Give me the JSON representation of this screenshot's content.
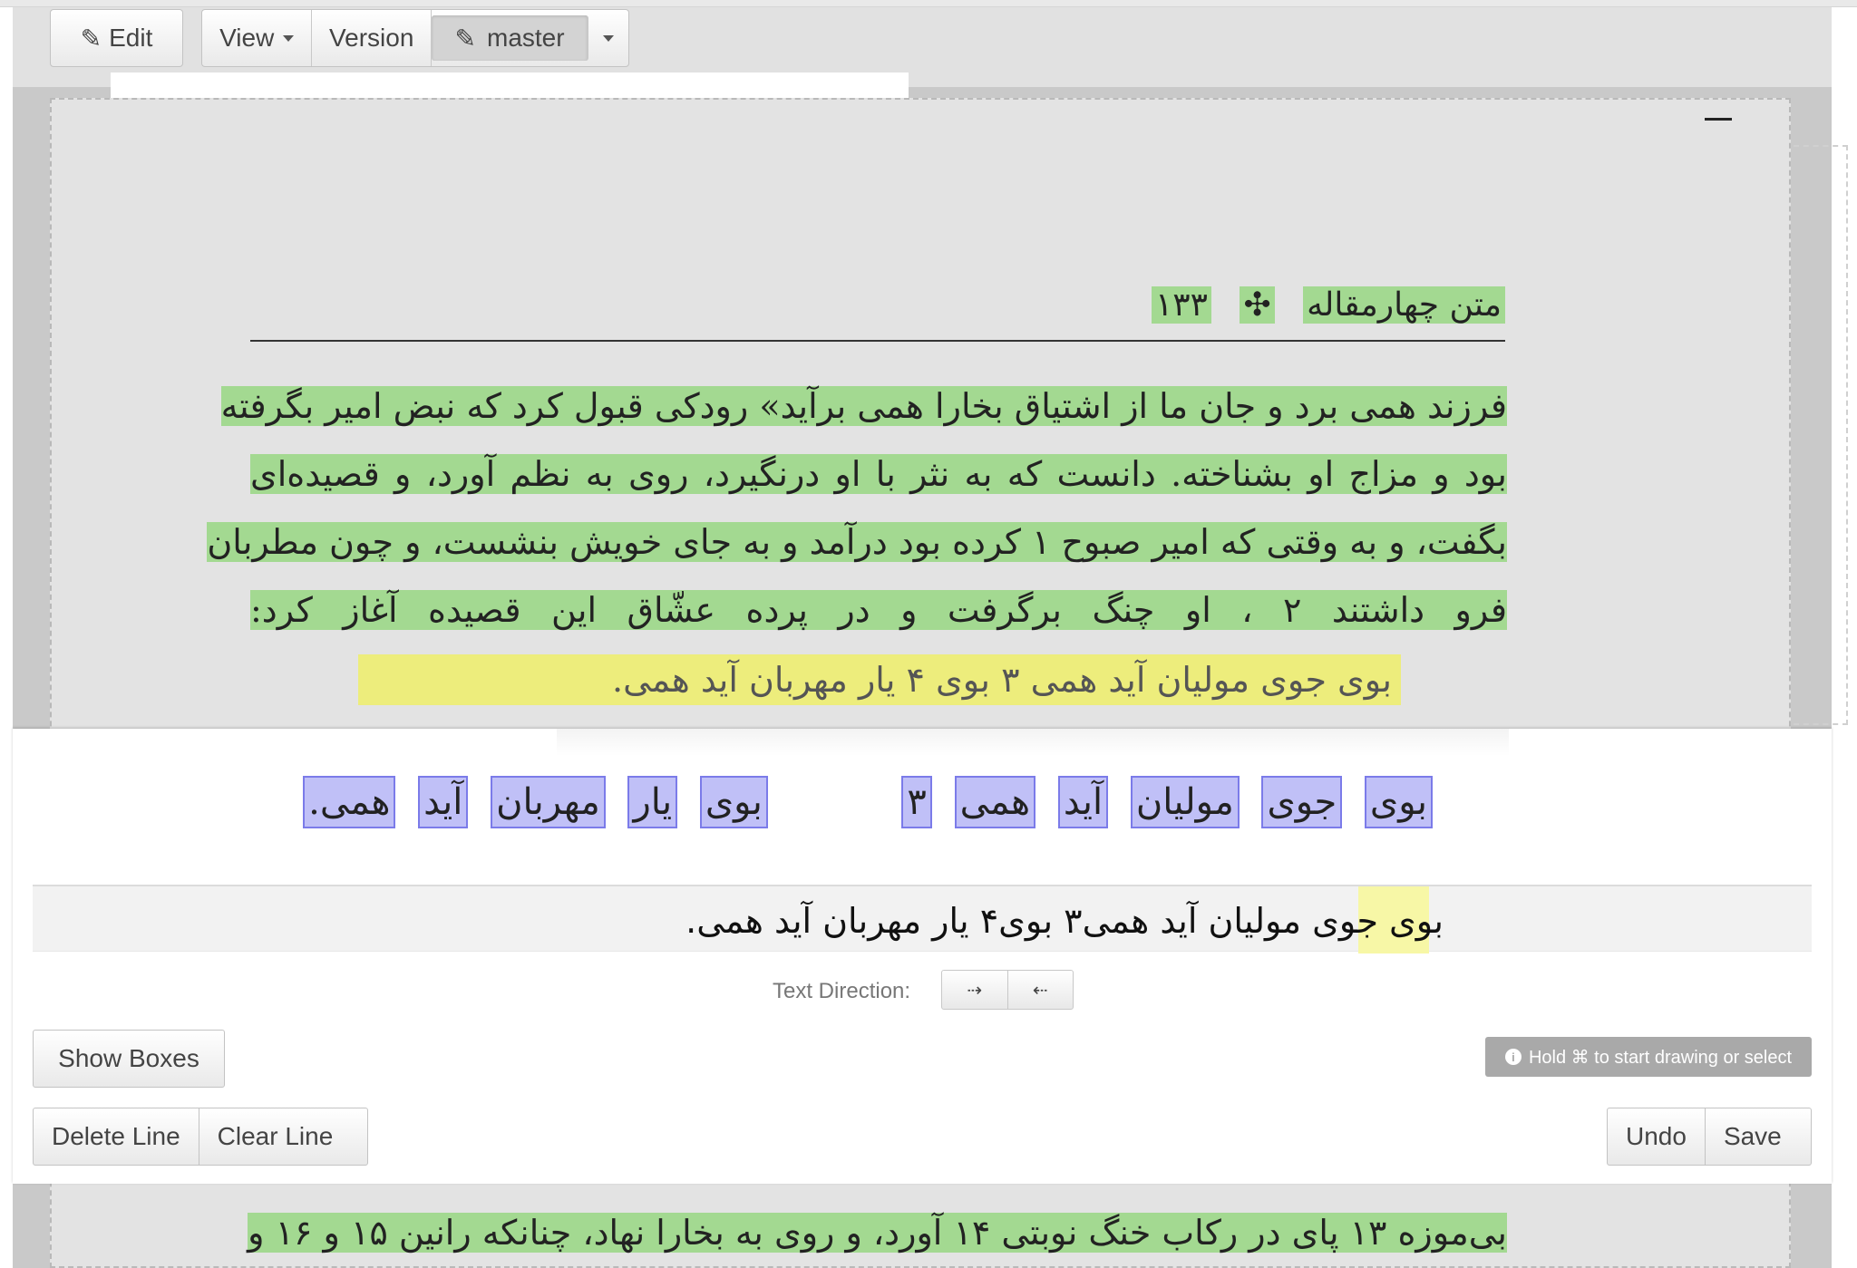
{
  "toolbar": {
    "edit_label": "Edit",
    "view_label": "View",
    "version_label": "Version",
    "branch_label": "master"
  },
  "page": {
    "header": [
      "متن چهارمقاله",
      "✣",
      "۱۳۳"
    ],
    "lines": [
      "فرزند همی برد و جان ما از اشتیاق بخارا همی برآید» رودکی قبول کرد که نبض امیر بگرفته",
      "بود و مزاج او بشناخته. دانست که به نثر با او درنگیرد، روی به نظم آورد، و قصیده‌ای",
      "بگفت، و به وقتی که امیر صبوح ۱ کرده بود درآمد و به جای خویش بنشست، و چون مطربان",
      "فرو داشتند ۲ ، او چنگ برگرفت و در پرده عشّاق این قصیده آغاز کرد:"
    ],
    "verse": "بوی جوی مولیان آید همی ۳          بوی ۴ یار مهربان آید همی.",
    "bottom_line": "بی‌موزه ۱۳ پای در رکاب خنگ نوبتی ۱۴ آورد، و روی به بخارا نهاد، چنانکه رانین ۱۵ و ۱۶ و"
  },
  "editor": {
    "crop_words": [
      "بوی",
      "جوی",
      "مولیان",
      "آید",
      "همی",
      "۳",
      "بوی",
      "یار",
      "مهربان",
      "آید",
      "همی."
    ],
    "line_text": "بوی جوی مولیان آید همی۳        بوی۴ یار مهربان آید همی.",
    "text_direction_label": "Text Direction:",
    "ltr_icon": "arrow-right-icon",
    "rtl_icon": "arrow-left-icon",
    "show_boxes_label": "Show Boxes",
    "hint_text": "Hold ⌘ to start drawing or select",
    "delete_line_label": "Delete Line",
    "clear_line_label": "Clear Line",
    "undo_label": "Undo",
    "save_label": "Save"
  },
  "colors": {
    "accent_green": "#78d25a",
    "accent_yellow": "#f0f05a",
    "box_blue": "#8c8cf0"
  }
}
